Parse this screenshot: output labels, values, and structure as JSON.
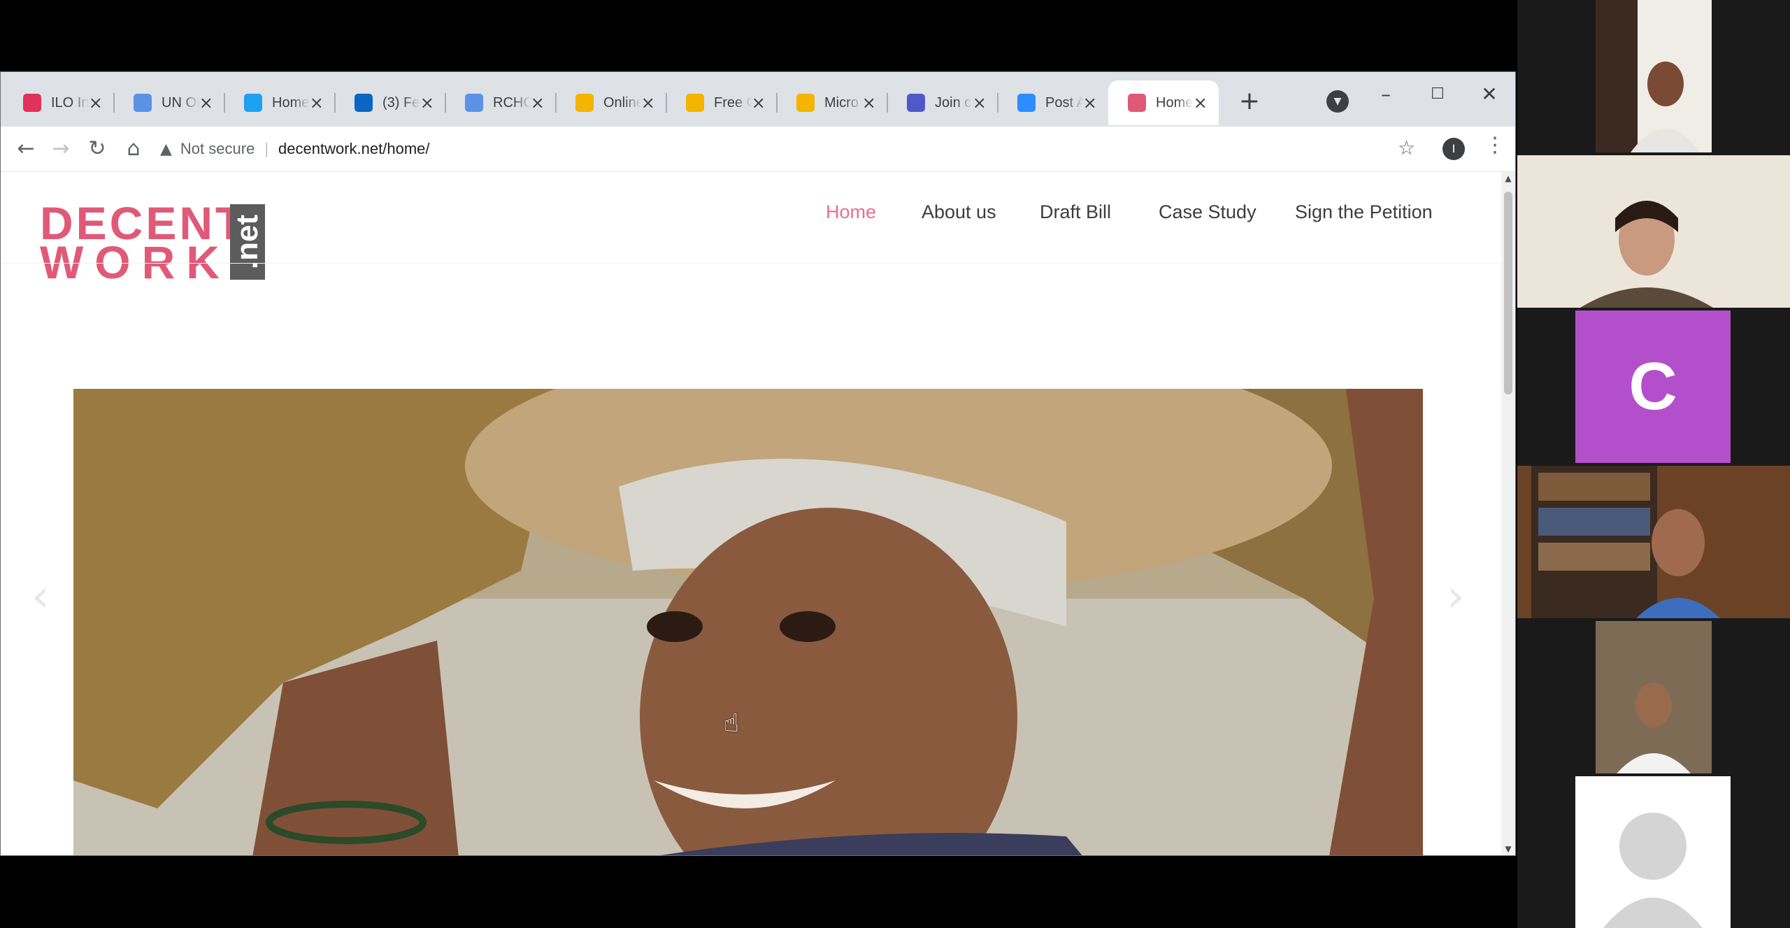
{
  "browser": {
    "tabs": [
      {
        "title": "ILO In",
        "icon": "ilo-icon",
        "color": "#e0325a"
      },
      {
        "title": "UN Or",
        "icon": "un-globe-icon",
        "color": "#5b92e5"
      },
      {
        "title": "Home",
        "icon": "twitter-icon",
        "color": "#1da1f2"
      },
      {
        "title": "(3) Fe",
        "icon": "linkedin-icon",
        "color": "#0a66c2"
      },
      {
        "title": "RCHC",
        "icon": "un-globe-icon",
        "color": "#5b92e5"
      },
      {
        "title": "Online",
        "icon": "drive-icon",
        "color": "#f4b400"
      },
      {
        "title": "Free C",
        "icon": "drive-icon",
        "color": "#f4b400"
      },
      {
        "title": "Micro",
        "icon": "drive-icon",
        "color": "#f4b400"
      },
      {
        "title": "Join c",
        "icon": "teams-icon",
        "color": "#5059c9"
      },
      {
        "title": "Post A",
        "icon": "zoom-icon",
        "color": "#2d8cff"
      },
      {
        "title": "Home",
        "icon": "wordpress-icon",
        "color": "#e05a78",
        "active": true
      }
    ],
    "new_tab": "+",
    "security_label": "Not secure",
    "url": "decentwork.net/home/",
    "profile_initial": "I"
  },
  "site": {
    "logo": {
      "line1": "DECENT",
      "line2": "WORK",
      "badge": ".net"
    },
    "nav": [
      "Home",
      "About us",
      "Draft Bill",
      "Case Study",
      "Sign the Petition"
    ],
    "active_nav": "Home",
    "hero_alt": "Woman carrying a bundle of straw on her head"
  },
  "meeting": {
    "participants": [
      {
        "name": "participant-1",
        "bg": "#2a2a2a"
      },
      {
        "name": "participant-2",
        "bg": "#e9e2d4"
      },
      {
        "name": "participant-3",
        "initial": "C",
        "bg": "#b44fcb"
      },
      {
        "name": "participant-4",
        "bg": "#5a3a24"
      },
      {
        "name": "participant-5",
        "bg": "#7a6a58"
      },
      {
        "name": "participant-6",
        "bg": "#ffffff"
      }
    ]
  }
}
